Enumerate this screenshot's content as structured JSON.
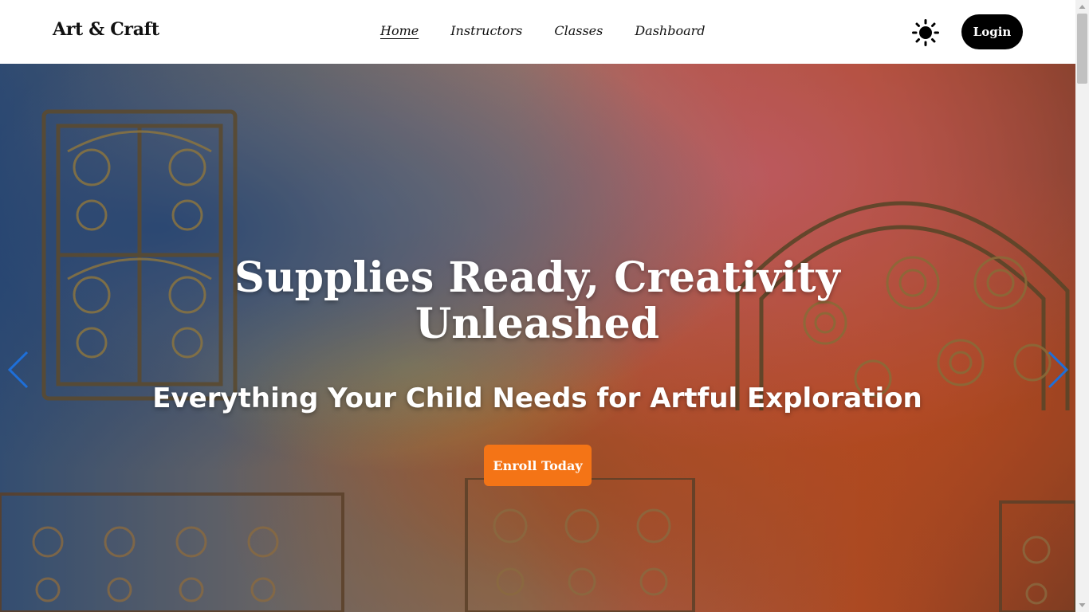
{
  "navbar": {
    "brand": "Art & Craft",
    "links": [
      {
        "label": "Home",
        "active": true
      },
      {
        "label": "Instructors",
        "active": false
      },
      {
        "label": "Classes",
        "active": false
      },
      {
        "label": "Dashboard",
        "active": false
      }
    ],
    "theme_toggle_icon": "sun-icon",
    "login_label": "Login"
  },
  "hero": {
    "title": "Supplies Ready, Creativity Unleashed",
    "subtitle": "Everything Your Child Needs for Artful Exploration",
    "cta_label": "Enroll Today",
    "prev_icon": "chevron-left-icon",
    "next_icon": "chevron-right-icon"
  },
  "colors": {
    "accent": "#f47416",
    "login_bg": "#000000",
    "carousel_arrow": "#1e6fd9"
  }
}
